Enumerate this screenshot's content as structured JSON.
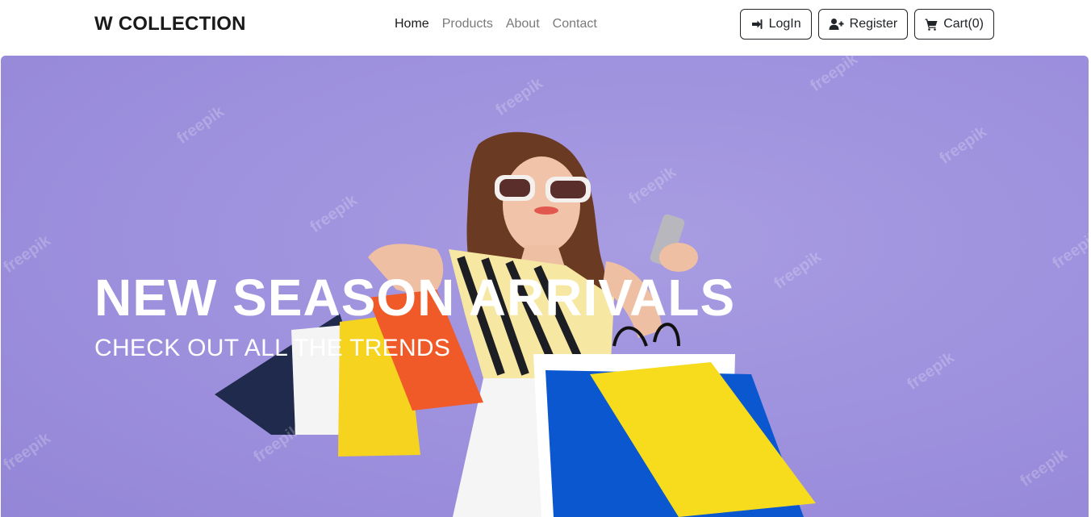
{
  "navbar": {
    "brand": "W COLLECTION",
    "links": [
      {
        "label": "Home",
        "active": true
      },
      {
        "label": "Products"
      },
      {
        "label": "About"
      },
      {
        "label": "Contact"
      }
    ],
    "buttons": {
      "login": {
        "label": "LogIn",
        "icon": "sign-in-icon"
      },
      "register": {
        "label": "Register",
        "icon": "user-plus-icon"
      },
      "cart": {
        "label": "Cart(0)",
        "icon": "cart-icon"
      }
    }
  },
  "hero": {
    "title": "NEW SEASON ARRIVALS",
    "subtitle": "CHECK OUT ALL THE TRENDS",
    "watermark": "freepik",
    "background_color": "#9d90dd"
  }
}
